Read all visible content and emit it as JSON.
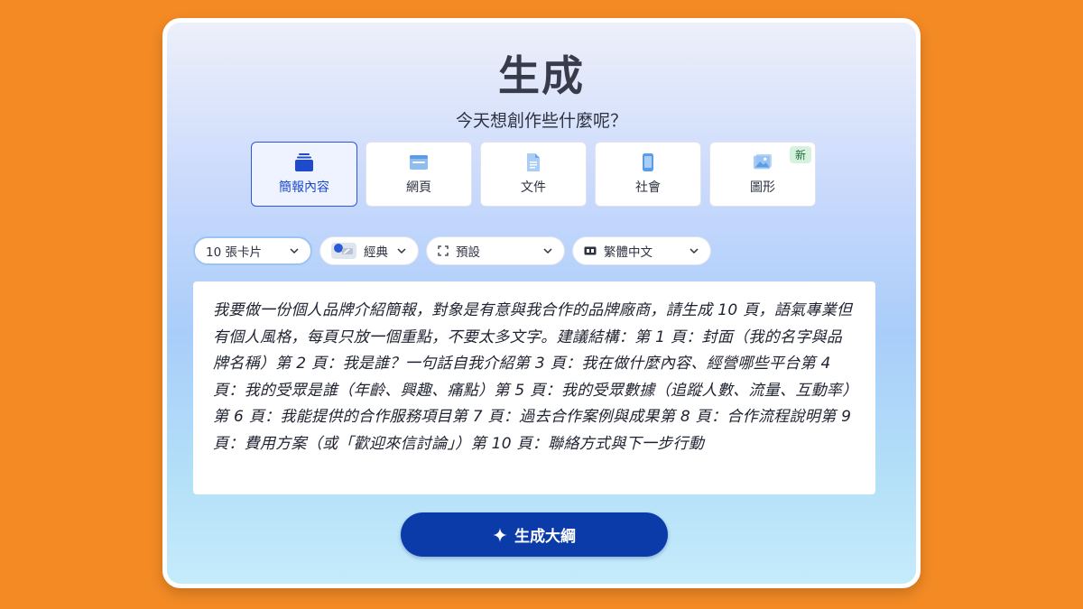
{
  "header": {
    "title": "生成",
    "subtitle": "今天想創作些什麼呢？"
  },
  "tabs": [
    {
      "label": "簡報內容",
      "icon": "presentation-icon",
      "active": true
    },
    {
      "label": "網頁",
      "icon": "webpage-icon",
      "active": false
    },
    {
      "label": "文件",
      "icon": "document-icon",
      "active": false
    },
    {
      "label": "社會",
      "icon": "phone-icon",
      "active": false
    },
    {
      "label": "圖形",
      "icon": "image-icon",
      "active": false,
      "badge": "新"
    }
  ],
  "options": {
    "cards": "10 張卡片",
    "theme": "經典",
    "layout": "預設",
    "language": "繁體中文"
  },
  "prompt": {
    "text": "我要做一份個人品牌介紹簡報，對象是有意與我合作的品牌廠商，請生成 10 頁，語氣專業但有個人風格，每頁只放一個重點，不要太多文字。建議結構：第 1 頁：封面（我的名字與品牌名稱）第 2 頁：我是誰？一句話自我介紹第 3 頁：我在做什麼內容、經營哪些平台第 4 頁：我的受眾是誰（年齡、興趣、痛點）第 5 頁：我的受眾數據（追蹤人數、流量、互動率）第 6 頁：我能提供的合作服務項目第 7 頁：過去合作案例與成果第 8 頁：合作流程說明第 9 頁：費用方案（或「歡迎來信討論」）第 10 頁：聯絡方式與下一步行動"
  },
  "actions": {
    "generate_label": "生成大綱"
  },
  "colors": {
    "background": "#f38a24",
    "accent": "#0a3ba8",
    "active_tab": "#2b59d8"
  }
}
